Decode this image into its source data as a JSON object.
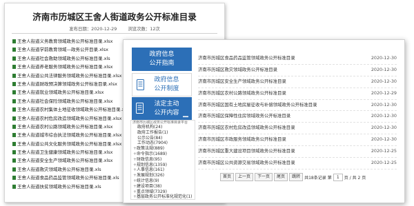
{
  "document": {
    "title": "济南市历城区王舍人街道政务公开标准目录",
    "publish_date": "发布日期：2020-12-29",
    "view_count": "浏览次数：12次",
    "files": [
      "王舍人街道义务教育领域政务公开标准目录.xlsx",
      "王舍人街道学前教育领域—政务公开目录.xlsx",
      "王舍人街道社会救助领域政务公开标准目录.xls",
      "王舍人街道养老服务领域政务公开标准目录.xlsx",
      "王舍人街道公共法律服务领域政务公开标准目录.xlsx",
      "王舍人街道财政预决算领域政务公开标准目录.xlsx",
      "王舍人街道就业领域政务公开标准目录.xlsx",
      "王舍人街道社会保险领域政务公开标准目录.xlsx",
      "王舍人街道农村集体土地征收领域政务公开标准目录.xlsx",
      "王舍人街道农村危房改造领域政务公开标准目录.xlsx",
      "王舍人街道农村公路领域政务公开标准目录.xlsx",
      "王舍人街道城市综合执法领域政务公开标准目录.xlsx",
      "王舍人街道公共文化服务领域政务公开标准目录.xlsx",
      "王舍人街道卫生健康领域政务公开标准目录.xlsx",
      "王舍人街道安全生产领域政务公开标准目录.xlsx",
      "王舍人街道救灾领域政务公开标准目录.xls",
      "王舍人街道食品药品监管领域政务公开标准目录.xls",
      "王舍人街道扶贫领域政务公开标准目录.xls"
    ]
  },
  "portal": {
    "nav": {
      "guide": "政府信息公开指南",
      "system": "政府信息公开制度",
      "active": "法定主动公开内容"
    },
    "tree": {
      "top_line": "济南市历城区政务公开标准目录平台",
      "items": [
        {
          "label": "政府机构(24)",
          "level": 2,
          "expander": ""
        },
        {
          "label": "政府工作报告(1)",
          "level": 2,
          "expander": ""
        },
        {
          "label": "公示公告(84)",
          "level": 2,
          "expander": ""
        },
        {
          "label": "工作动态(7904)",
          "level": 2,
          "expander": ""
        },
        {
          "label": "政策法规(889)",
          "level": 1,
          "expander": "+"
        },
        {
          "label": "命令指示(1689)",
          "level": 1,
          "expander": "+"
        },
        {
          "label": "财政信息(95)",
          "level": 1,
          "expander": "+"
        },
        {
          "label": "规划信息(1359)",
          "level": 1,
          "expander": "+"
        },
        {
          "label": "人事信息(161)",
          "level": 1,
          "expander": "+"
        },
        {
          "label": "发展规划(326)",
          "level": 1,
          "expander": "+"
        },
        {
          "label": "统计信息(9)",
          "level": 1,
          "expander": "+"
        },
        {
          "label": "建设项目(38)",
          "level": 1,
          "expander": "+"
        },
        {
          "label": "重点领域(7329)",
          "level": 1,
          "expander": "+"
        },
        {
          "label": "基层政务公开标准化规范化(1)",
          "level": 1,
          "expander": "+"
        }
      ]
    },
    "list": [
      {
        "title": "济南市历城区食品药品监管领域政务公开标准目录",
        "date": "2020-12-30"
      },
      {
        "title": "济南市历城区救灾领域政务公开标准目录",
        "date": "2020-12-30"
      },
      {
        "title": "济南市历城区安全生产领域政务公开标准目录",
        "date": "2020-12-30"
      },
      {
        "title": "济南市历城区农村公路领域政务公开标准目录",
        "date": "2020-12-29"
      },
      {
        "title": "济南市历城区国有土地房屋征收与补偿领域政务公开标准目录",
        "date": "2020-12-30"
      },
      {
        "title": "济南市历城区保障性住房领域政务公开标准目录",
        "date": "2020-12-30"
      },
      {
        "title": "济南市历城区农村危房改造领域政务公开标准目录",
        "date": "2020-12-30"
      },
      {
        "title": "济南市历城区市政服务领域政务公开标准目录",
        "date": "2020-12-30"
      },
      {
        "title": "济南市历城区重大建设项目领域政务公开标准目录",
        "date": "2020-12-25"
      },
      {
        "title": "济南市历城区公共资源交易领域政务公开标准目录",
        "date": "2020-12-25"
      }
    ],
    "pager": {
      "first": "首页",
      "prev": "上一页",
      "next": "下一页",
      "last": "尾页",
      "jump": "跳转",
      "total": "共18条记录",
      "page_prefix": "第",
      "current_page": "1",
      "page_suffix": "页 / 共 2 页"
    }
  },
  "colors": {
    "accent": "#2c6fb7",
    "xls_icon": "#2e7d32"
  },
  "icons": {
    "file": "xlsx-file-icon",
    "doc": "document-icon",
    "collapse": "minus-icon"
  }
}
